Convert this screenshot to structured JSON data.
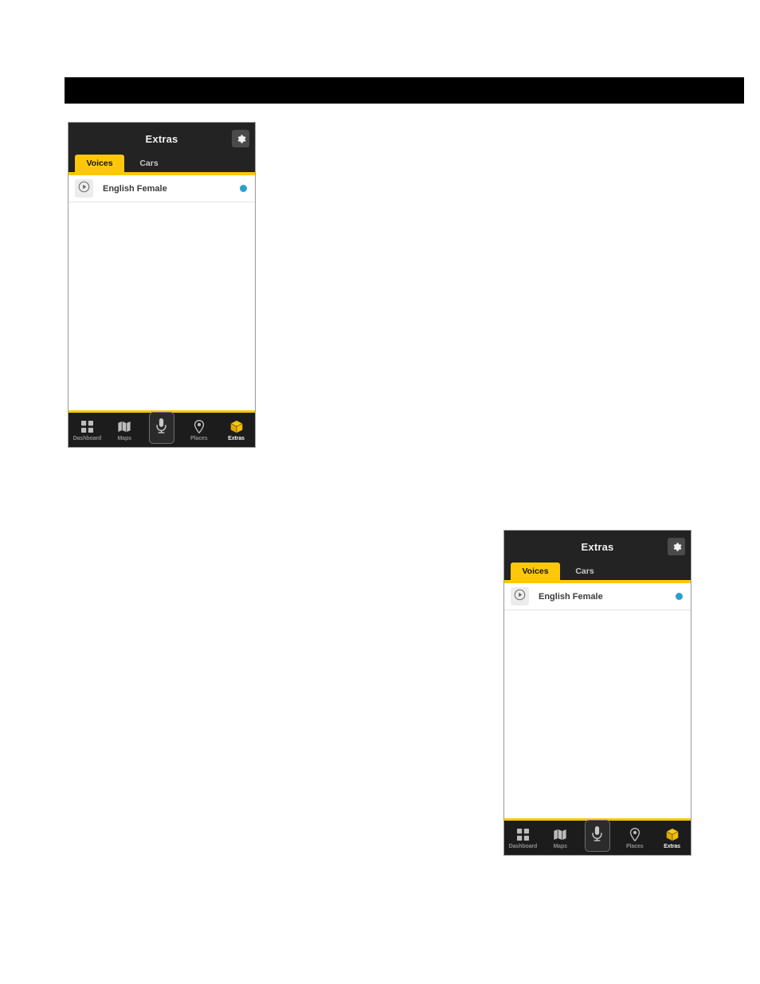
{
  "page": {
    "background_color": "#ffffff",
    "banner_color": "#000000"
  },
  "theme": {
    "accent": "#ffc709",
    "header_bg": "#232323",
    "nav_bg": "#1c1c1c",
    "status_dot": "#2ba0cf",
    "label_muted": "#8d8d8d"
  },
  "banner": {
    "label": ""
  },
  "screens": [
    {
      "id": "screenshot-top",
      "header": {
        "title": "Extras",
        "settings_icon": "gear-icon"
      },
      "tabs": [
        {
          "label": "Voices",
          "active": true
        },
        {
          "label": "Cars",
          "active": false
        }
      ],
      "list": [
        {
          "play_icon": "play-circle-icon",
          "label": "English Female",
          "status_icon": "blue-dot-indicator",
          "status_color": "#2ba0cf"
        }
      ],
      "bottom_nav": [
        {
          "label": "Dashboard",
          "icon": "dashboard-grid-icon",
          "active": false
        },
        {
          "label": "Maps",
          "icon": "map-folded-icon",
          "active": false
        },
        {
          "label": "",
          "icon": "microphone-icon",
          "active": false,
          "is_mic": true
        },
        {
          "label": "Places",
          "icon": "location-pin-icon",
          "active": false
        },
        {
          "label": "Extras",
          "icon": "cube-box-icon",
          "active": true
        }
      ]
    },
    {
      "id": "screenshot-bottom",
      "header": {
        "title": "Extras",
        "settings_icon": "gear-icon"
      },
      "tabs": [
        {
          "label": "Voices",
          "active": true
        },
        {
          "label": "Cars",
          "active": false
        }
      ],
      "list": [
        {
          "play_icon": "play-circle-icon",
          "label": "English Female",
          "status_icon": "blue-dot-indicator",
          "status_color": "#2ba0cf"
        }
      ],
      "bottom_nav": [
        {
          "label": "Dashboard",
          "icon": "dashboard-grid-icon",
          "active": false
        },
        {
          "label": "Maps",
          "icon": "map-folded-icon",
          "active": false
        },
        {
          "label": "",
          "icon": "microphone-icon",
          "active": false,
          "is_mic": true
        },
        {
          "label": "Places",
          "icon": "location-pin-icon",
          "active": false
        },
        {
          "label": "Extras",
          "icon": "cube-box-icon",
          "active": true
        }
      ]
    }
  ]
}
